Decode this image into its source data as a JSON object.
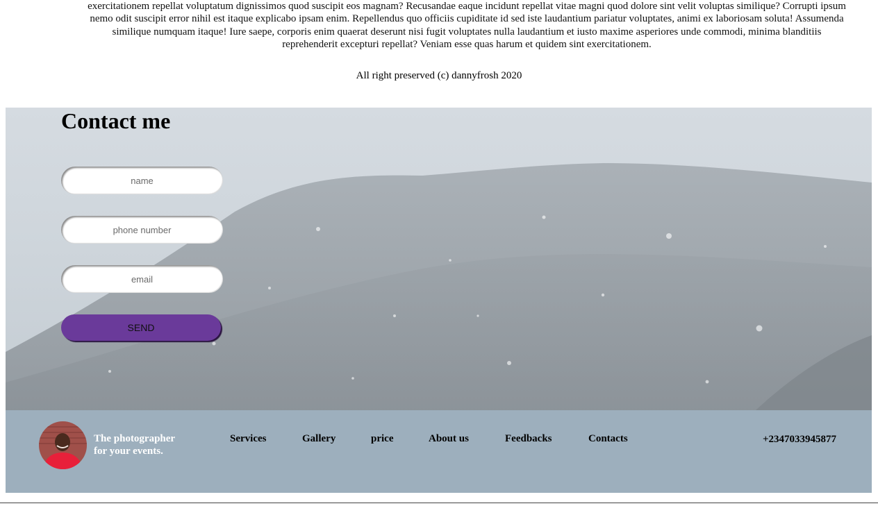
{
  "intro": {
    "lines": [
      "exercitationem repellat voluptatum dignissimos quod suscipit eos magnam? Recusandae eaque incidunt repellat vitae magni quod dolore sint velit voluptas similique? Corrupti ipsum",
      "nemo odit suscipit error nihil est itaque explicabo ipsam enim. Repellendus quo officiis cupiditate id sed iste laudantium pariatur voluptates, animi ex laboriosam soluta! Assumenda",
      "similique numquam itaque! Iure saepe, corporis enim quaerat deserunt nisi fugit voluptates nulla laudantium et iusto maxime asperiores unde commodi, minima blanditiis",
      "reprehenderit excepturi repellat? Veniam esse quas harum et quidem sint exercitationem."
    ]
  },
  "contact": {
    "title": "Contact me",
    "name_placeholder": "name",
    "phone_placeholder": "phone number",
    "email_placeholder": "email",
    "send_label": "SEND",
    "accent_color": "#6a3a9a"
  },
  "footer": {
    "tagline_line1": "The photographer",
    "tagline_line2": "for your events.",
    "nav": [
      "Services",
      "Gallery",
      "price",
      "About us",
      "Feedbacks",
      "Contacts"
    ],
    "phone": "+2347033945877",
    "copyright": "All right preserved (c) dannyfrosh 2020",
    "background_color": "#9dafbd"
  }
}
